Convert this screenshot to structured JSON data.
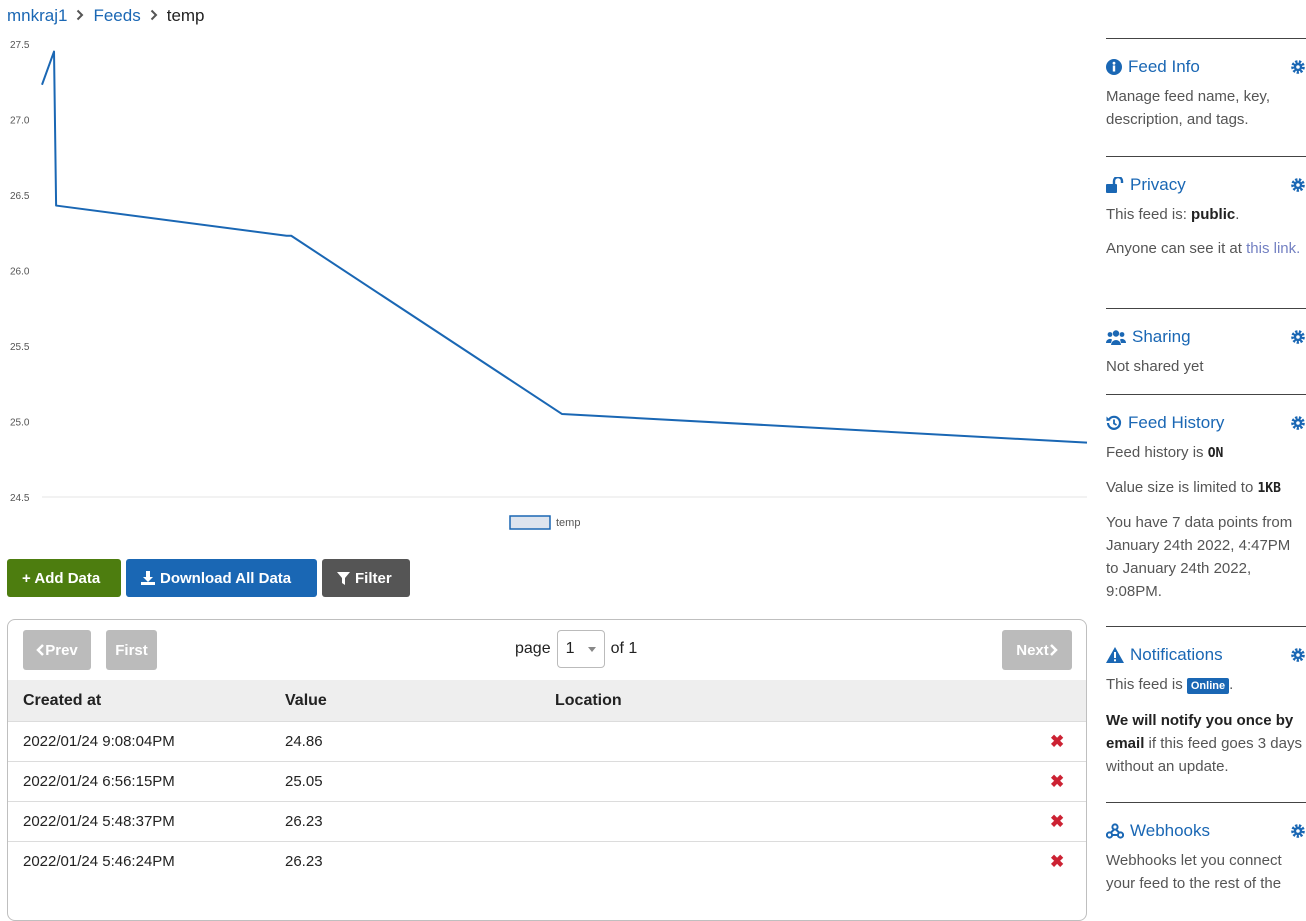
{
  "breadcrumb": {
    "user": "mnkraj1",
    "feeds": "Feeds",
    "current": "temp"
  },
  "chart_data": {
    "type": "line",
    "ylim": [
      24.5,
      27.5
    ],
    "yticks": [
      "27.5",
      "27.0",
      "26.5",
      "26.0",
      "25.5",
      "25.0",
      "24.5"
    ],
    "series": [
      {
        "name": "temp",
        "values": [
          27.23,
          27.45,
          26.43,
          26.23,
          26.23,
          25.05,
          24.86
        ]
      }
    ],
    "x_positions": [
      0.0,
      0.0115,
      0.0135,
      0.234,
      0.2385,
      0.4975,
      1.0
    ],
    "legend": "bottom-center",
    "color": "#1a67b4"
  },
  "buttons": {
    "add": "+ Add Data",
    "download": "Download All Data",
    "filter": "Filter"
  },
  "pager": {
    "prev": "Prev",
    "first": "First",
    "page_label": "page",
    "page_value": "1",
    "of_label": "of 1",
    "next": "Next"
  },
  "table": {
    "headers": [
      "Created at",
      "Value",
      "Location"
    ],
    "rows": [
      {
        "created": "2022/01/24 9:08:04PM",
        "value": "24.86",
        "location": "",
        "delete": "✖"
      },
      {
        "created": "2022/01/24 6:56:15PM",
        "value": "25.05",
        "location": "",
        "delete": "✖"
      },
      {
        "created": "2022/01/24 5:48:37PM",
        "value": "26.23",
        "location": "",
        "delete": "✖"
      },
      {
        "created": "2022/01/24 5:46:24PM",
        "value": "26.23",
        "location": "",
        "delete": "✖"
      }
    ]
  },
  "sidebar": {
    "feed_info": {
      "title": "Feed Info",
      "desc": "Manage feed name, key, description, and tags."
    },
    "privacy": {
      "title": "Privacy",
      "is_label": "This feed is:",
      "is_value": "public",
      "anyone": "Anyone can see it at",
      "link": "this link",
      "link_end": "."
    },
    "sharing": {
      "title": "Sharing",
      "desc": "Not shared yet"
    },
    "history": {
      "title": "Feed History",
      "is_label": "Feed history is",
      "is_value": "ON",
      "limit_label": "Value size is limited to",
      "limit_value": "1KB",
      "points": "You have 7 data points from January 24th 2022, 4:47PM to January 24th 2022, 9:08PM."
    },
    "notifications": {
      "title": "Notifications",
      "is_label": "This feed is",
      "badge": "Online",
      "badge_end": ".",
      "notify_bold": "We will notify you once by",
      "notify_email": "email",
      "notify_rest": "if this feed goes 3 days without an update."
    },
    "webhooks": {
      "title": "Webhooks",
      "desc": "Webhooks let you connect your feed to the rest of the"
    }
  }
}
